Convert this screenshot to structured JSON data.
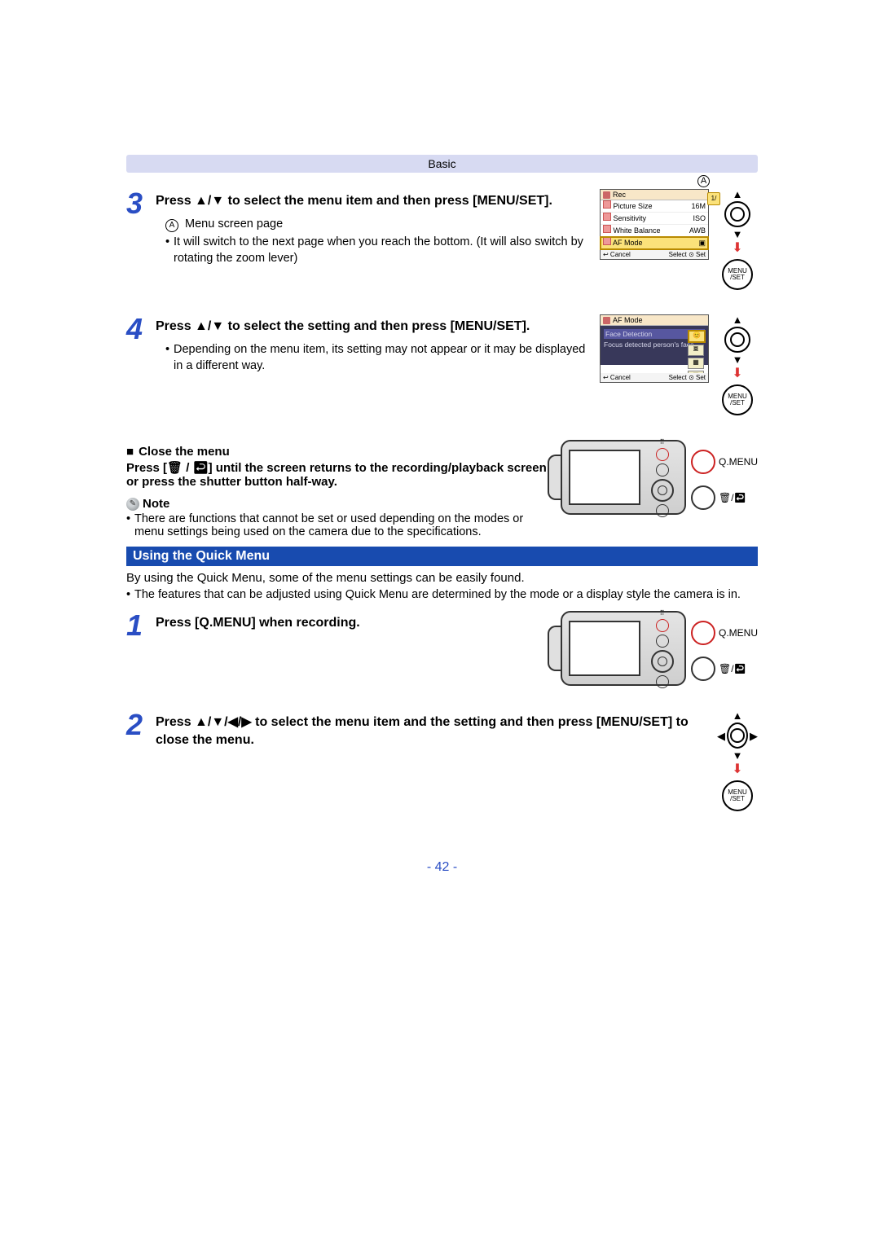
{
  "header": {
    "section": "Basic"
  },
  "steps": {
    "s3": {
      "num": "3",
      "title_a": "Press ",
      "title_b": " to select the menu item and then press [MENU/SET].",
      "arrows": "▲/▼",
      "sub_marker": "A",
      "sub_label": "Menu screen page",
      "bullet": "It will switch to the next page when you reach the bottom. (It will also switch by rotating the zoom lever)"
    },
    "s4": {
      "num": "4",
      "title_a": "Press ",
      "title_b": " to select the setting and then press [MENU/SET].",
      "arrows": "▲/▼",
      "bullet": "Depending on the menu item, its setting may not appear or it may be displayed in a different way."
    }
  },
  "close_menu": {
    "heading": "Close the menu",
    "line1_a": "Press [",
    "line1_b": "] until the screen returns to the recording/playback screen or press the shutter button half-way.",
    "icon_glyph": "🗑 / ↩"
  },
  "note": {
    "label": "Note",
    "text": "There are functions that cannot be set or used depending on the modes or menu settings being used on the camera due to the specifications."
  },
  "quick_menu": {
    "bar": "Using the Quick Menu",
    "intro": "By using the Quick Menu, some of the menu settings can be easily found.",
    "bullet": "The features that can be adjusted using Quick Menu are determined by the mode or a display style the camera is in.",
    "step1": {
      "num": "1",
      "title": "Press [Q.MENU] when recording."
    },
    "step2": {
      "num": "2",
      "title_a": "Press ",
      "title_b": " to select the menu item and the setting and then press [MENU/SET] to close the menu.",
      "arrows": "▲/▼/◀/▶"
    }
  },
  "menu_shot": {
    "title": "Rec",
    "callout": "A",
    "side_tab": "1/",
    "items": [
      {
        "label": "Picture Size",
        "value": "16M"
      },
      {
        "label": "Sensitivity",
        "value": "ISO"
      },
      {
        "label": "White Balance",
        "value": "AWB"
      },
      {
        "label": "AF Mode",
        "value": "▣",
        "selected": true
      },
      {
        "label": "",
        "value": "",
        "dark": true
      }
    ],
    "footer_left": "↩ Cancel",
    "footer_right": "Select ⊙ Set"
  },
  "af_shot": {
    "title": "AF Mode",
    "detail_title": "Face Detection",
    "detail_text": "Focus detected person's face",
    "options": [
      "😊",
      "🞖",
      "▦",
      "▣"
    ],
    "selected_index": 0,
    "footer_left": "↩ Cancel",
    "footer_right": "Select ⊙ Set"
  },
  "dpad": {
    "menu": "MENU",
    "set": "/SET"
  },
  "camera_buttons": {
    "qmenu": "Q.MENU",
    "trash_back": "🗑/↩"
  },
  "page_number": "- 42 -"
}
